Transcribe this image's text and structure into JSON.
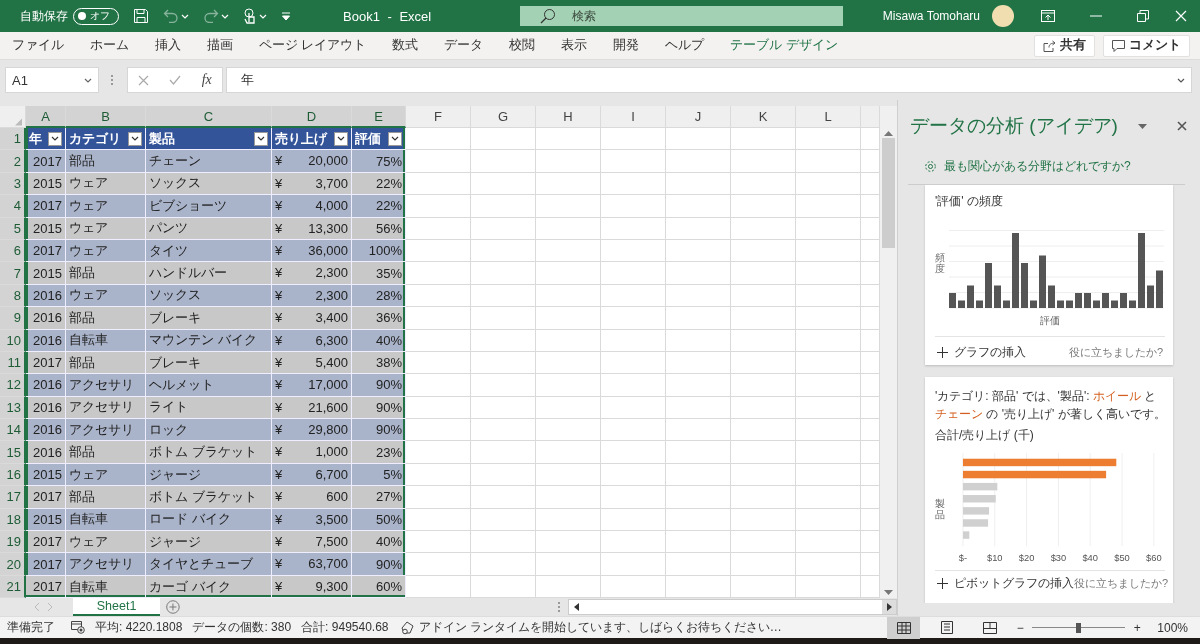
{
  "title_bar": {
    "autosave": {
      "label": "自動保存",
      "state": "オフ",
      "on": false
    },
    "quick_access": [
      {
        "kind": "save",
        "disabled": false
      },
      {
        "kind": "undo",
        "disabled": true
      },
      {
        "kind": "redo",
        "disabled": true
      },
      {
        "kind": "touch",
        "disabled": false
      },
      {
        "kind": "customize",
        "disabled": false
      }
    ],
    "title": "Book1 - Excel",
    "search": {
      "placeholder": "検索"
    },
    "user": "Misawa Tomoharu"
  },
  "ribbon": {
    "tabs": [
      {
        "label": "ファイル",
        "kind": "normal"
      },
      {
        "label": "ホーム",
        "kind": "normal"
      },
      {
        "label": "挿入",
        "kind": "normal"
      },
      {
        "label": "描画",
        "kind": "normal"
      },
      {
        "label": "ページ レイアウト",
        "kind": "normal"
      },
      {
        "label": "数式",
        "kind": "normal"
      },
      {
        "label": "データ",
        "kind": "normal"
      },
      {
        "label": "校閲",
        "kind": "normal"
      },
      {
        "label": "表示",
        "kind": "normal"
      },
      {
        "label": "開発",
        "kind": "normal"
      },
      {
        "label": "ヘルプ",
        "kind": "normal"
      },
      {
        "label": "テーブル デザイン",
        "kind": "contextual"
      }
    ],
    "share": "共有",
    "comment": "コメント"
  },
  "formula_bar": {
    "name_box": "A1",
    "fx": "fx",
    "value": "年"
  },
  "sheet": {
    "columns": [
      {
        "label": "A",
        "selected": true
      },
      {
        "label": "B",
        "selected": true
      },
      {
        "label": "C",
        "selected": true
      },
      {
        "label": "D",
        "selected": true
      },
      {
        "label": "E",
        "selected": true
      },
      {
        "label": "F",
        "selected": false
      },
      {
        "label": "G",
        "selected": false
      },
      {
        "label": "H",
        "selected": false
      },
      {
        "label": "I",
        "selected": false
      },
      {
        "label": "J",
        "selected": false
      },
      {
        "label": "K",
        "selected": false
      },
      {
        "label": "L",
        "selected": false
      }
    ],
    "header_row": {
      "num": "1",
      "selected": true,
      "cells": [
        "年",
        "カテゴリ",
        "製品",
        "売り上げ",
        "評価"
      ]
    },
    "rows": [
      {
        "num": "2",
        "selected": true,
        "cells": [
          "2017",
          "部品",
          "チェーン",
          "¥ 20,000",
          "75%"
        ]
      },
      {
        "num": "3",
        "selected": true,
        "cells": [
          "2015",
          "ウェア",
          "ソックス",
          "¥ 3,700",
          "22%"
        ]
      },
      {
        "num": "4",
        "selected": true,
        "cells": [
          "2017",
          "ウェア",
          "ビブショーツ",
          "¥ 4,000",
          "22%"
        ]
      },
      {
        "num": "5",
        "selected": true,
        "cells": [
          "2015",
          "ウェア",
          "パンツ",
          "¥ 13,300",
          "56%"
        ]
      },
      {
        "num": "6",
        "selected": true,
        "cells": [
          "2017",
          "ウェア",
          "タイツ",
          "¥ 36,000",
          "100%"
        ]
      },
      {
        "num": "7",
        "selected": true,
        "cells": [
          "2015",
          "部品",
          "ハンドルバー",
          "¥ 2,300",
          "35%"
        ]
      },
      {
        "num": "8",
        "selected": true,
        "cells": [
          "2016",
          "ウェア",
          "ソックス",
          "¥ 2,300",
          "28%"
        ]
      },
      {
        "num": "9",
        "selected": true,
        "cells": [
          "2016",
          "部品",
          "ブレーキ",
          "¥ 3,400",
          "36%"
        ]
      },
      {
        "num": "10",
        "selected": true,
        "cells": [
          "2016",
          "自転車",
          "マウンテン バイク",
          "¥ 6,300",
          "40%"
        ]
      },
      {
        "num": "11",
        "selected": true,
        "cells": [
          "2017",
          "部品",
          "ブレーキ",
          "¥ 5,400",
          "38%"
        ]
      },
      {
        "num": "12",
        "selected": true,
        "cells": [
          "2016",
          "アクセサリ",
          "ヘルメット",
          "¥ 17,000",
          "90%"
        ]
      },
      {
        "num": "13",
        "selected": true,
        "cells": [
          "2016",
          "アクセサリ",
          "ライト",
          "¥ 21,600",
          "90%"
        ]
      },
      {
        "num": "14",
        "selected": true,
        "cells": [
          "2016",
          "アクセサリ",
          "ロック",
          "¥ 29,800",
          "90%"
        ]
      },
      {
        "num": "15",
        "selected": true,
        "cells": [
          "2016",
          "部品",
          "ボトム ブラケット",
          "¥ 1,000",
          "23%"
        ]
      },
      {
        "num": "16",
        "selected": true,
        "cells": [
          "2015",
          "ウェア",
          "ジャージ",
          "¥ 6,700",
          "5%"
        ]
      },
      {
        "num": "17",
        "selected": true,
        "cells": [
          "2017",
          "部品",
          "ボトム ブラケット",
          "¥ 600",
          "27%"
        ]
      },
      {
        "num": "18",
        "selected": true,
        "cells": [
          "2015",
          "自転車",
          "ロード バイク",
          "¥ 3,500",
          "50%"
        ]
      },
      {
        "num": "19",
        "selected": true,
        "cells": [
          "2017",
          "ウェア",
          "ジャージ",
          "¥ 7,500",
          "40%"
        ]
      },
      {
        "num": "20",
        "selected": true,
        "cells": [
          "2017",
          "アクセサリ",
          "タイヤとチューブ",
          "¥ 63,700",
          "90%"
        ]
      },
      {
        "num": "21",
        "selected": true,
        "cells": [
          "2017",
          "自転車",
          "カーゴ バイク",
          "¥ 9,300",
          "60%"
        ]
      }
    ]
  },
  "sheet_tabs": [
    {
      "label": "Sheet1",
      "selected": true
    }
  ],
  "ideas_pane": {
    "title": "データの分析 (アイデア)",
    "interest_link": "最も関心がある分野はどれですか?",
    "cards": [
      {
        "kind": "histogram",
        "title": "'評価' の頻度",
        "ylabel": "頻度",
        "xlabel": "評価",
        "action": "グラフの挿入",
        "feedback": "役に立ちましたか?"
      },
      {
        "kind": "insight",
        "insight": [
          {
            "text": "'カテゴリ: 部品' では、'製品': ",
            "highlight": false
          },
          {
            "text": "ホイール",
            "highlight": true
          },
          {
            "text": " と ",
            "highlight": false
          },
          {
            "text": "チェーン",
            "highlight": true
          },
          {
            "text": " の '売り上げ' が著しく高いです。",
            "highlight": false
          }
        ],
        "chart_data": {
          "type": "bar",
          "orientation": "horizontal",
          "title": "合計/売り上げ (千)",
          "ylabel": "製品",
          "xlim": [
            0,
            60
          ],
          "stacked": true,
          "grid": true,
          "xticks": [
            {
              "value": 0,
              "label": "$-"
            },
            {
              "value": 10,
              "label": "$10"
            },
            {
              "value": 20,
              "label": "$20"
            },
            {
              "value": 30,
              "label": "$30"
            },
            {
              "value": 40,
              "label": "$40"
            },
            {
              "value": 50,
              "label": "$50"
            },
            {
              "value": 60,
              "label": "$60"
            }
          ],
          "series": [
            {
              "color": "#ed7d31",
              "values": [
                48.2,
                45,
                null,
                null,
                null,
                null,
                null
              ]
            },
            {
              "color": "#d0d0d0",
              "values": [
                null,
                null,
                10.8,
                10.3,
                8.2,
                7.9,
                2
              ]
            }
          ]
        },
        "action": "ピボットグラフの挿入",
        "feedback": "役に立ちましたか?"
      }
    ]
  },
  "status_bar": {
    "ready": "準備完了",
    "stats": [
      "平均: 4220.1808",
      "データの個数: 380",
      "合計: 949540.68"
    ],
    "message": "アドイン ランタイムを開始しています、しばらくお待ちください…",
    "views": [
      {
        "kind": "normal",
        "selected": true
      },
      {
        "kind": "page_layout",
        "selected": false
      },
      {
        "kind": "page_break",
        "selected": false
      }
    ],
    "zoom_out": "−",
    "zoom_in": "+",
    "zoom": {
      "level": 0.5,
      "value": "100%"
    }
  }
}
